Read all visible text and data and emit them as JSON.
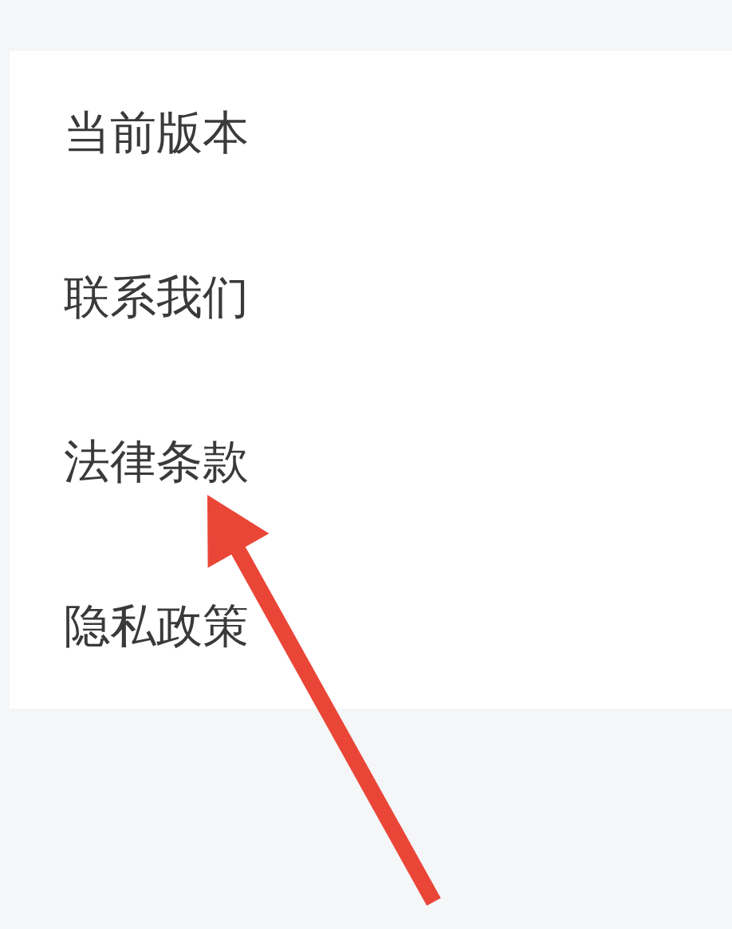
{
  "settings_list": {
    "items": [
      {
        "label": "当前版本"
      },
      {
        "label": "联系我们"
      },
      {
        "label": "法律条款"
      },
      {
        "label": "隐私政策"
      }
    ]
  }
}
